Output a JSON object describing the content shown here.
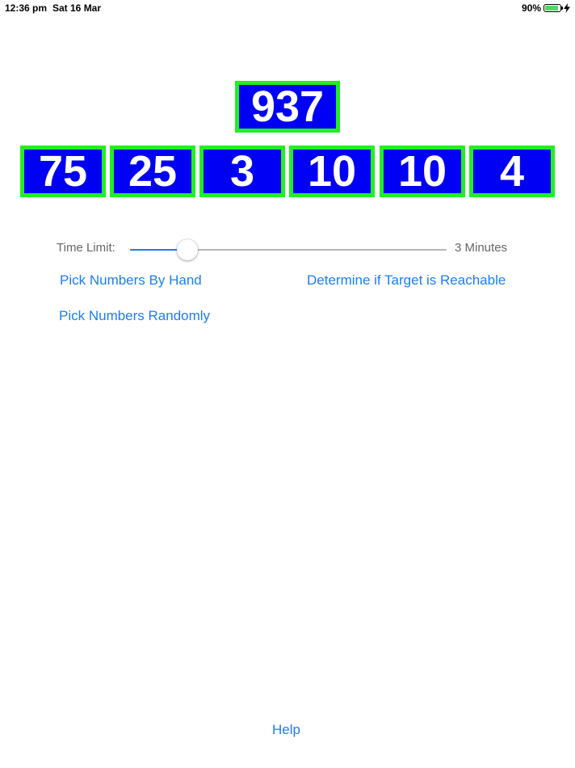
{
  "status_bar": {
    "time": "12:36 pm",
    "date": "Sat 16 Mar",
    "battery_percent": "90%",
    "battery_level": 0.9
  },
  "target": "937",
  "numbers": [
    "75",
    "25",
    "3",
    "10",
    "10",
    "4"
  ],
  "time_limit": {
    "label": "Time Limit:",
    "value_text": "3 Minutes",
    "slider_fraction": 0.18
  },
  "actions": {
    "pick_by_hand": "Pick Numbers By Hand",
    "determine_reachable": "Determine if Target is Reachable",
    "pick_randomly": "Pick Numbers Randomly",
    "help": "Help"
  },
  "colors": {
    "tile_background": "#0000f5",
    "tile_border": "#22ee22",
    "tile_text": "#ffffff",
    "link": "#1b7ef0",
    "battery": "#4cd964"
  }
}
